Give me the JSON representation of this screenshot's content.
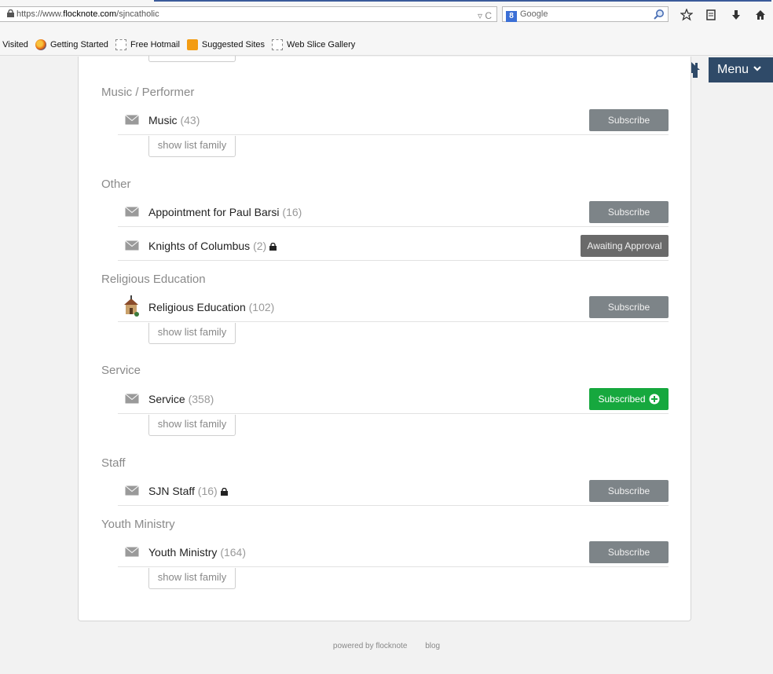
{
  "browser": {
    "url_prefix": "https://www.",
    "url_domain": "flocknote.com",
    "url_path": "/sjncatholic",
    "search_engine": "Google",
    "bookmarks": [
      "t Visited",
      "Getting Started",
      "Free Hotmail",
      "Suggested Sites",
      "Web Slice Gallery"
    ]
  },
  "header": {
    "menu_label": "Menu"
  },
  "sections": [
    {
      "title": "Music / Performer"
    },
    {
      "title": "Other"
    },
    {
      "title": "Religious Education"
    },
    {
      "title": "Service"
    },
    {
      "title": "Staff"
    },
    {
      "title": "Youth Ministry"
    }
  ],
  "lists": [
    {
      "name": "Music",
      "count": "(43)",
      "action": "Subscribe",
      "show_family": "show list family"
    },
    {
      "name": "Appointment for Paul Barsi",
      "count": "(16)",
      "action": "Subscribe"
    },
    {
      "name": "Knights of Columbus",
      "count": "(2)",
      "action": "Awaiting Approval"
    },
    {
      "name": "Religious Education",
      "count": "(102)",
      "action": "Subscribe",
      "show_family": "show list family"
    },
    {
      "name": "Service",
      "count": "(358)",
      "action": "Subscribed",
      "show_family": "show list family"
    },
    {
      "name": "SJN Staff",
      "count": "(16)",
      "action": "Subscribe"
    },
    {
      "name": "Youth Ministry",
      "count": "(164)",
      "action": "Subscribe",
      "show_family": "show list family"
    }
  ],
  "footer": {
    "powered": "powered by flocknote",
    "blog": "blog"
  },
  "colors": {
    "nav_bg": "#2f4a68",
    "subscribed_green": "#16a83e",
    "subscribe_gray": "#7d8488"
  }
}
